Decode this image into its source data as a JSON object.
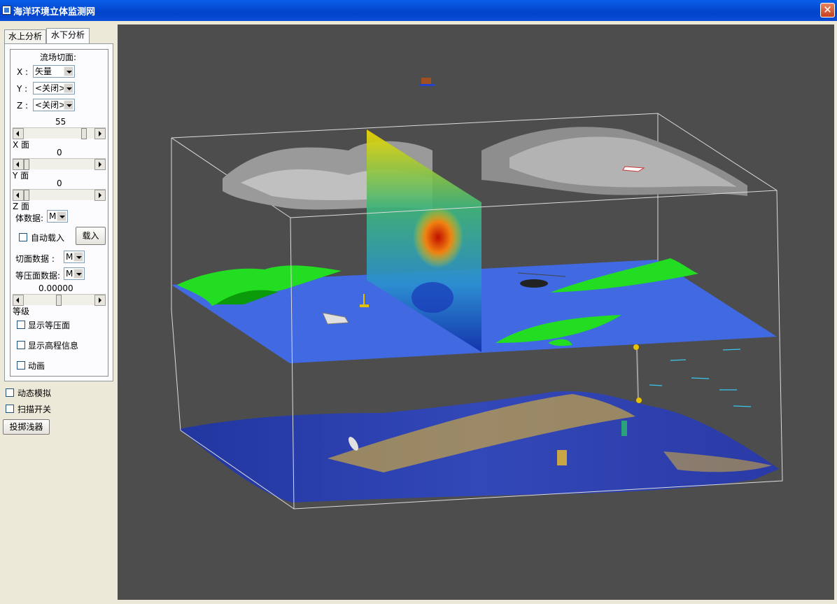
{
  "window": {
    "title": "海洋环境立体监测网",
    "close_symbol": "✕"
  },
  "tabs": [
    {
      "label": "水上分析",
      "active": false
    },
    {
      "label": "水下分析",
      "active": true
    }
  ],
  "panel": {
    "group_title": "流场切面:",
    "x_axis_label": "X :",
    "x_select": "矢量",
    "y_axis_label": "Y :",
    "y_select": "<关闭>",
    "z_axis_label": "Z :",
    "z_select": "<关闭>",
    "x_slider_value": "55",
    "x_plane_label": "X 面",
    "y_slider_value": "0",
    "y_plane_label": "Y 面",
    "z_slider_value": "0",
    "z_plane_label": "Z 面",
    "volume_data_label": "体数据:",
    "volume_data_value": "M",
    "auto_load_label": "自动载入",
    "load_button": "载入",
    "slice_data_label": "切面数据   :",
    "slice_data_value": "M",
    "isosurface_data_label": "等压面数据:",
    "isosurface_data_value": "M",
    "level_value": "0.00000",
    "level_label": "等级",
    "show_isosurface_label": "显示等压面",
    "show_elevation_label": "显示高程信息",
    "animation_label": "动画"
  },
  "bottom": {
    "dynamic_sim_label": "动态模拟",
    "scan_switch_label": "扫描开关",
    "throw_button": "投掷浅器"
  },
  "colors": {
    "titlebar": "#0a4ed8",
    "viewport_bg": "#4d4d4d",
    "sea_surface": "#4169e1",
    "land": "#22dd22",
    "seabed": "#2b3fa8",
    "seabed_high": "#c8a545"
  },
  "icons": {
    "app": "app-window-icon",
    "close": "close-icon",
    "dropdown": "chevron-down-icon"
  }
}
